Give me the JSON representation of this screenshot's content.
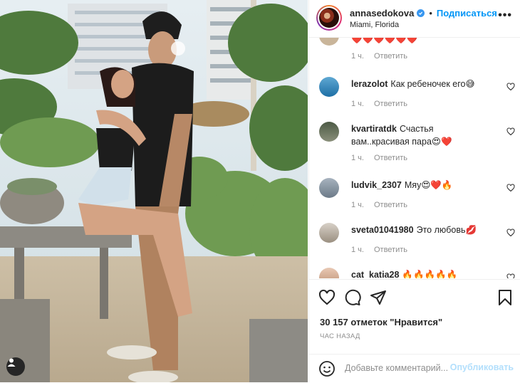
{
  "header": {
    "username": "annasedokova",
    "separator": "•",
    "follow_label": "Подписаться",
    "location": "Miami, Florida",
    "more_icon": "more-horizontal-icon"
  },
  "comments": [
    {
      "username": "",
      "text": "❤️❤️❤️❤️❤️❤️",
      "time": "1 ч.",
      "reply": "Ответить"
    },
    {
      "username": "lerazolot",
      "text": "Как ребеночек его😅",
      "time": "1 ч.",
      "reply": "Ответить"
    },
    {
      "username": "kvartiratdk",
      "text": "Счастья вам..красивая пара😍❤️",
      "time": "1 ч.",
      "reply": "Ответить"
    },
    {
      "username": "ludvik_2307",
      "text": "Мяу😍❤️🔥",
      "time": "1 ч.",
      "reply": "Ответить"
    },
    {
      "username": "sveta01041980",
      "text": "Это любовь💋",
      "time": "1 ч.",
      "reply": "Ответить"
    },
    {
      "username": "cat_katia28",
      "text": "🔥🔥🔥🔥🔥",
      "time": "",
      "reply": ""
    }
  ],
  "actions": {
    "likes": "30 157 отметок \"Нравится\"",
    "time_ago": "ЧАС НАЗАД"
  },
  "add_comment": {
    "placeholder": "Добавьте комментарий...",
    "post_label": "Опубликовать"
  },
  "colors": {
    "link_blue": "#0095f6",
    "post_disabled": "#b2dffc",
    "secondary_text": "#8e8e8e",
    "border": "#efefef"
  }
}
